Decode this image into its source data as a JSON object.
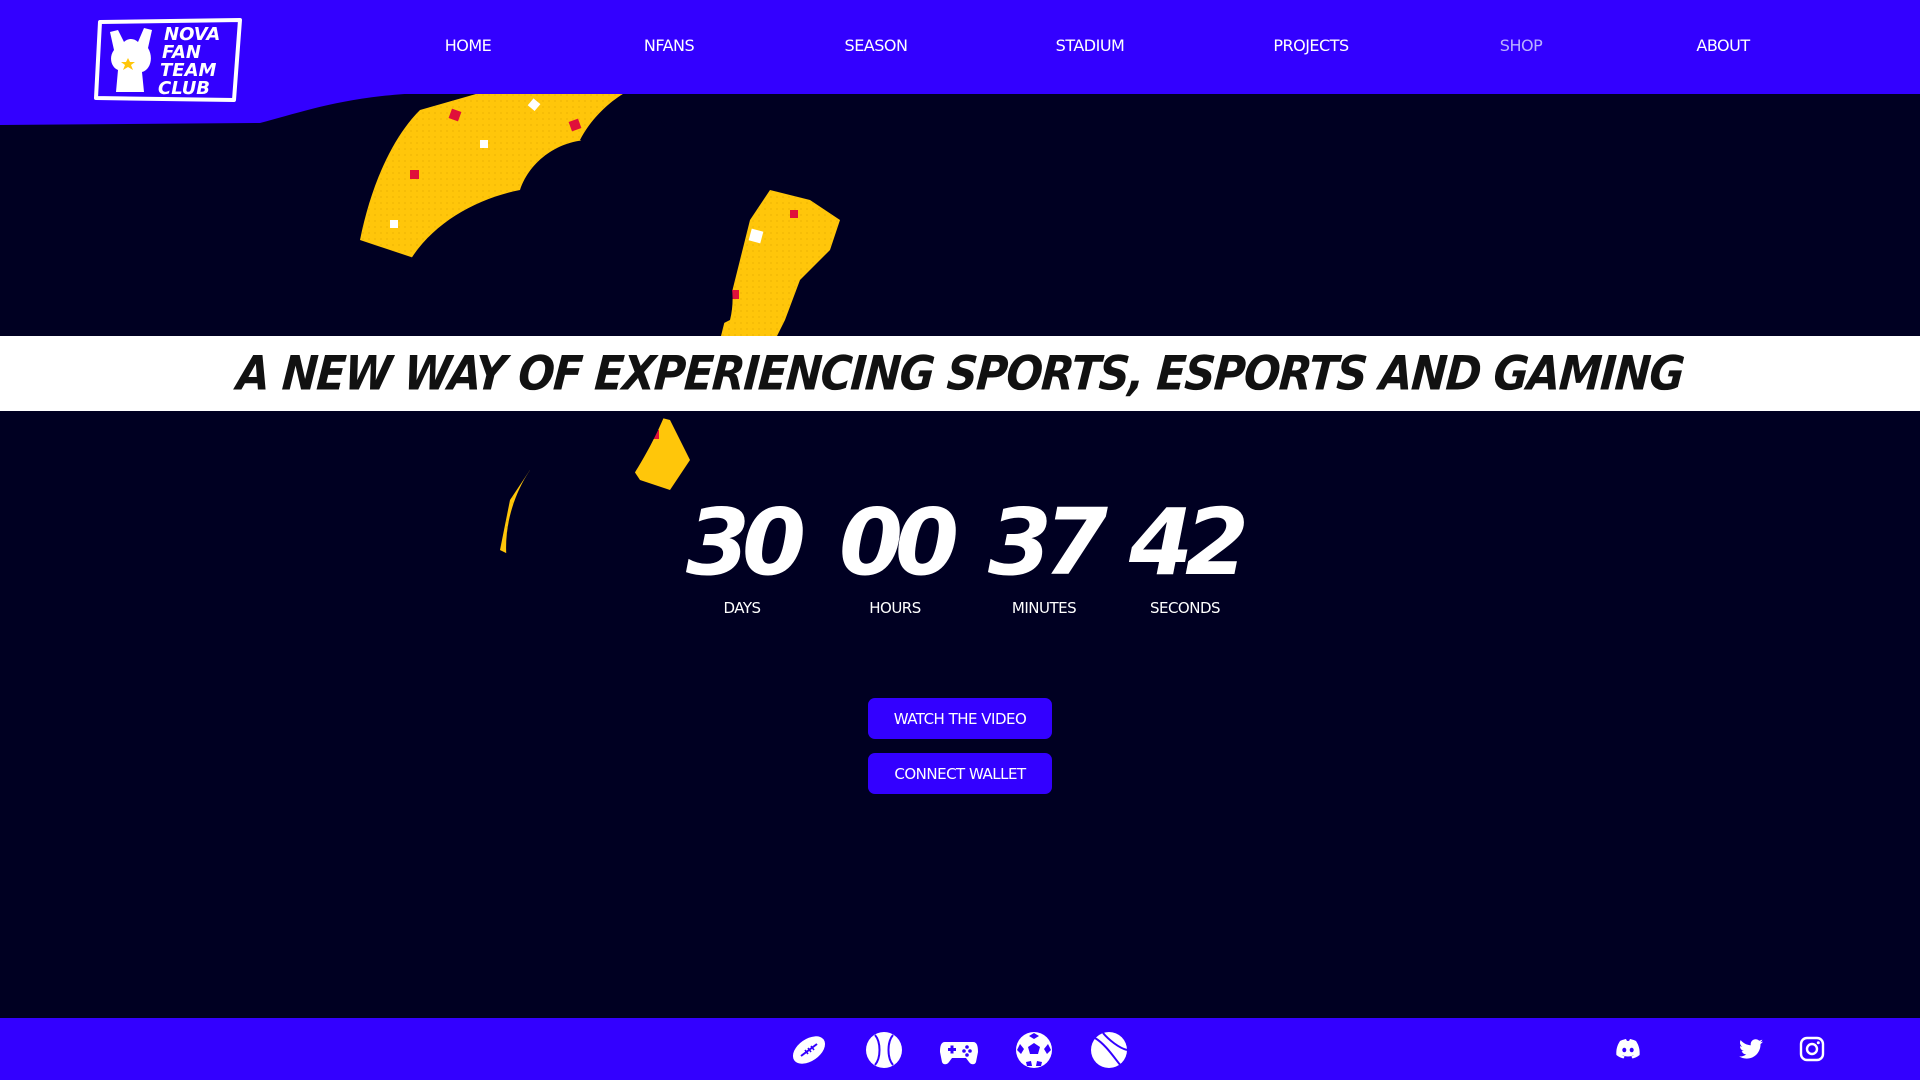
{
  "header": {
    "logo_lines": [
      "NOVA",
      "FAN",
      "TEAM",
      "CLUB"
    ],
    "nav": [
      {
        "label": "HOME"
      },
      {
        "label": "NFANS"
      },
      {
        "label": "SEASON"
      },
      {
        "label": "STADIUM"
      },
      {
        "label": "PROJECTS"
      },
      {
        "label": "SHOP"
      },
      {
        "label": "ABOUT"
      }
    ],
    "active_item": "SHOP"
  },
  "hero": {
    "tagline": "A NEW WAY OF EXPERIENCING SPORTS, ESPORTS AND GAMING"
  },
  "countdown": {
    "days": {
      "value": "30",
      "label": "DAYS"
    },
    "hours": {
      "value": "00",
      "label": "HOURS"
    },
    "minutes": {
      "value": "37",
      "label": "MINUTES"
    },
    "seconds": {
      "value": "42",
      "label": "SECONDS"
    }
  },
  "actions": {
    "watch_video": "WATCH THE VIDEO",
    "connect_wallet": "CONNECT WALLET"
  },
  "footer": {
    "sport_icons": [
      "american-football-icon",
      "baseball-icon",
      "gamepad-icon",
      "soccer-ball-icon",
      "tennis-ball-icon"
    ],
    "social_icons": [
      "discord-icon",
      "twitter-icon",
      "instagram-icon"
    ]
  },
  "colors": {
    "brand_blue": "#3300ff",
    "background": "#000022",
    "accent_yellow": "#ffc60a",
    "confetti_red": "#e0103a",
    "banner": "#ffffff"
  }
}
